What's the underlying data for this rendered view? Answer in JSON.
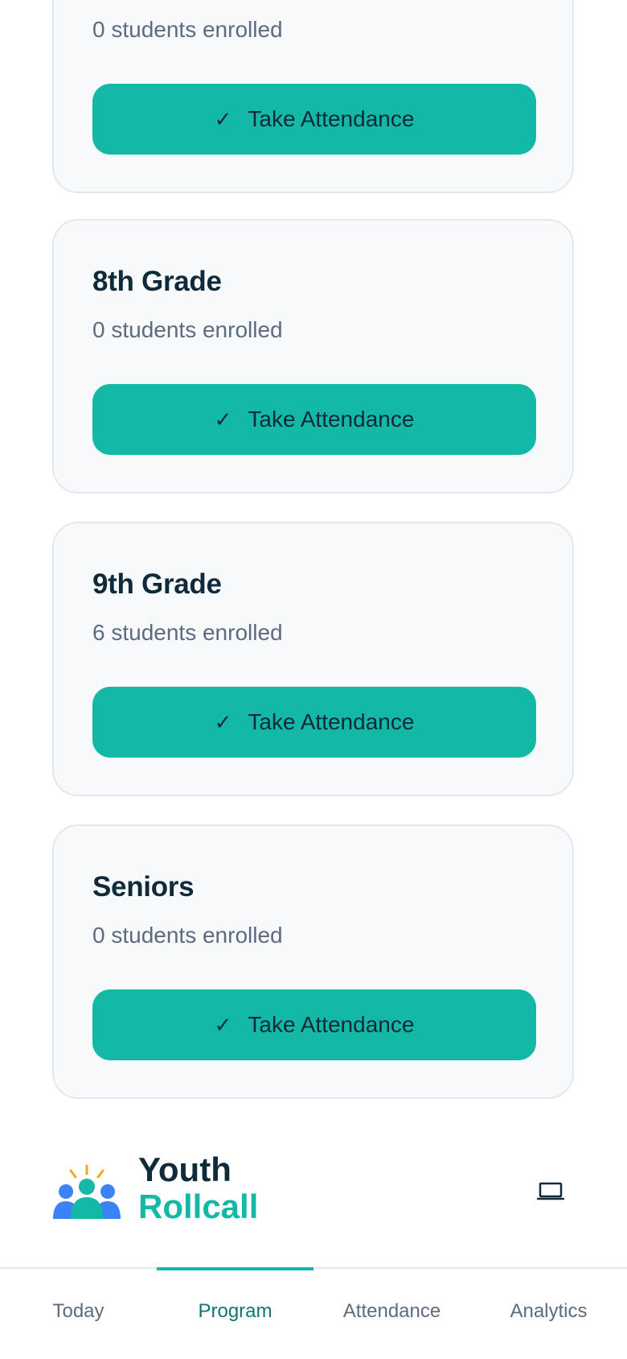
{
  "classes": [
    {
      "title": "",
      "count_text": "0 students enrolled",
      "button_label": "Take Attendance"
    },
    {
      "title": "8th Grade",
      "count_text": "0 students enrolled",
      "button_label": "Take Attendance"
    },
    {
      "title": "9th Grade",
      "count_text": "6 students enrolled",
      "button_label": "Take Attendance"
    },
    {
      "title": "Seniors",
      "count_text": "0 students enrolled",
      "button_label": "Take Attendance"
    }
  ],
  "brand": {
    "line1": "Youth",
    "line2": "Rollcall"
  },
  "check_glyph": "✓",
  "nav": {
    "tabs": [
      {
        "label": "Today"
      },
      {
        "label": "Program"
      },
      {
        "label": "Attendance"
      },
      {
        "label": "Analytics"
      }
    ],
    "active": "Program"
  },
  "colors": {
    "accent": "#14b8a6",
    "text": "#0f2a3a",
    "muted": "#5c6b7f",
    "card_bg": "#f7f9fb"
  }
}
